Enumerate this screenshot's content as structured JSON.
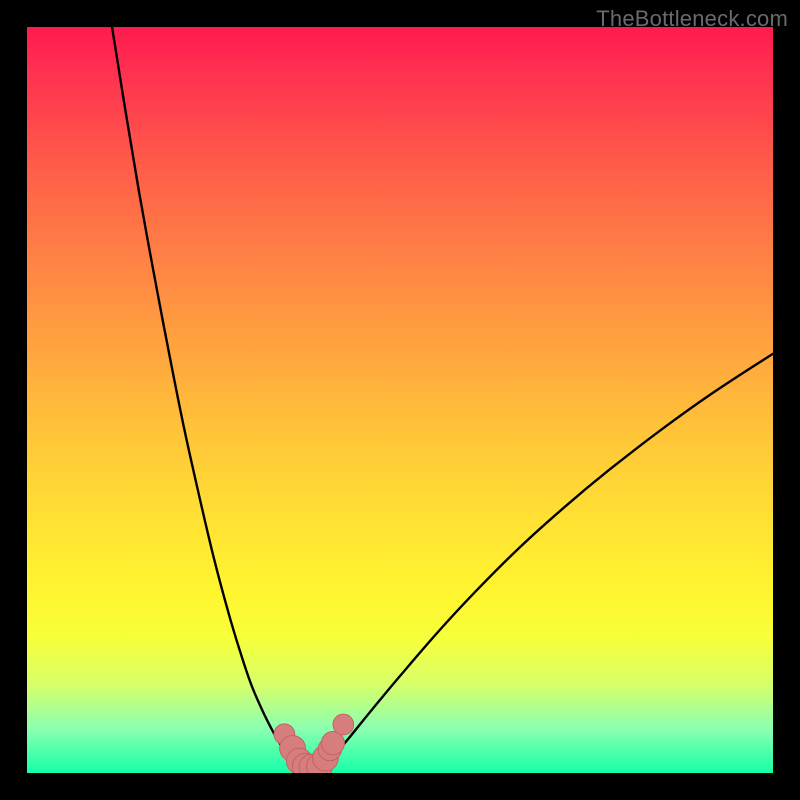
{
  "watermark": "TheBottleneck.com",
  "colors": {
    "background_black": "#000000",
    "gradient_top": "#ff1a4f",
    "gradient_bottom": "#15ffa8",
    "curve": "#000000",
    "marker_fill": "#d67e7e",
    "marker_stroke": "#c46262"
  },
  "chart_data": {
    "type": "line",
    "title": "",
    "xlabel": "",
    "ylabel": "",
    "xlim": [
      0,
      100
    ],
    "ylim": [
      0,
      100
    ],
    "grid": false,
    "series": [
      {
        "name": "left-curve",
        "x": [
          11.4,
          13,
          15,
          17,
          19,
          21,
          23,
          25,
          27,
          28.5,
          30,
          31.5,
          33,
          34,
          35,
          36,
          36.8
        ],
        "y": [
          100,
          90,
          78,
          67,
          56.5,
          46.5,
          37.5,
          29,
          21.5,
          16.5,
          12,
          8.5,
          5.5,
          3.8,
          2.5,
          1.5,
          1.0
        ]
      },
      {
        "name": "right-curve",
        "x": [
          39.7,
          41,
          43,
          46,
          50,
          55,
          60,
          66,
          72,
          78,
          85,
          92,
          100
        ],
        "y": [
          1.0,
          2.2,
          4.5,
          8.2,
          13.0,
          18.8,
          24.2,
          30.2,
          35.6,
          40.6,
          46.0,
          51.0,
          56.2
        ]
      },
      {
        "name": "valley-line",
        "x": [
          36.8,
          37.3,
          38.0,
          38.8,
          39.3,
          39.7
        ],
        "y": [
          1.0,
          0.6,
          0.45,
          0.45,
          0.6,
          1.0
        ]
      }
    ],
    "markers": {
      "name": "valley-markers",
      "points": [
        {
          "x": 34.5,
          "y": 5.2,
          "r": 1.0
        },
        {
          "x": 35.6,
          "y": 3.3,
          "r": 1.4
        },
        {
          "x": 36.5,
          "y": 1.6,
          "r": 1.4
        },
        {
          "x": 37.3,
          "y": 0.9,
          "r": 1.4
        },
        {
          "x": 38.2,
          "y": 0.8,
          "r": 1.4
        },
        {
          "x": 39.2,
          "y": 0.9,
          "r": 1.4
        },
        {
          "x": 40.0,
          "y": 2.0,
          "r": 1.4
        },
        {
          "x": 40.6,
          "y": 3.2,
          "r": 1.2
        },
        {
          "x": 41.0,
          "y": 4.0,
          "r": 1.2
        },
        {
          "x": 42.4,
          "y": 6.5,
          "r": 1.0
        }
      ]
    },
    "legend": false
  }
}
